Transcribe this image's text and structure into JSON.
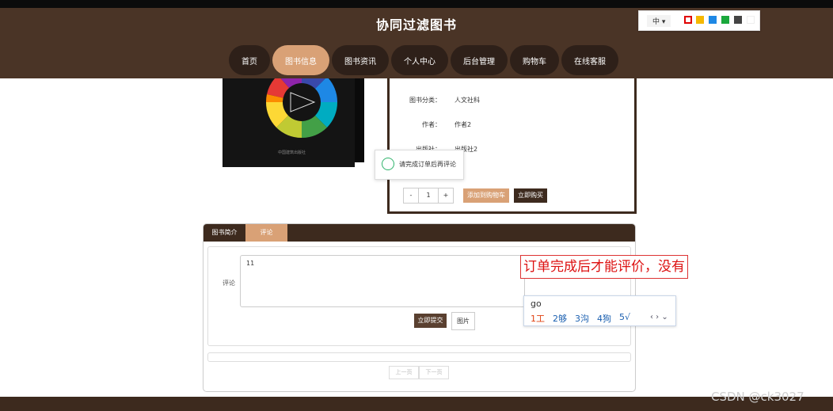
{
  "header": {
    "title": "协同过滤图书"
  },
  "nav": [
    {
      "label": "首页",
      "active": false
    },
    {
      "label": "图书信息",
      "active": true
    },
    {
      "label": "图书资讯",
      "active": false
    },
    {
      "label": "个人中心",
      "active": false
    },
    {
      "label": "后台管理",
      "active": false
    },
    {
      "label": "购物车",
      "active": false
    },
    {
      "label": "在线客服",
      "active": false
    }
  ],
  "theme": {
    "lang": "中 ▾",
    "colors": [
      "#e00000",
      "#f5b800",
      "#1e88e5",
      "#1aa83c",
      "#444444",
      "#ffffff"
    ]
  },
  "book": {
    "publisher_print": "中国建筑出版社"
  },
  "details": {
    "category_label": "图书分类：",
    "category": "人文社科",
    "author_label": "作者：",
    "author": "作者2",
    "publisher_label": "出版社：",
    "publisher": "出版社2"
  },
  "purchase": {
    "minus": "-",
    "qty": "1",
    "plus": "+",
    "add_to_cart": "添加到购物车",
    "buy_now": "立即购买"
  },
  "toast": {
    "text": "请完成订单后再评论"
  },
  "tabs": [
    {
      "label": "图书简介",
      "active": false
    },
    {
      "label": "评论",
      "active": true
    }
  ],
  "comment": {
    "label": "评论",
    "text": "11",
    "submit": "立即提交",
    "image": "图片"
  },
  "pager": {
    "prev": "上一页",
    "next": "下一页"
  },
  "annotation": {
    "text": "订单完成后才能评价，没有"
  },
  "ime": {
    "input": "go",
    "candidates": [
      "1工",
      "2够",
      "3沟",
      "4狗",
      "5√"
    ],
    "nav": "‹ › ⌄"
  },
  "watermark": "CSDN @ck3027"
}
